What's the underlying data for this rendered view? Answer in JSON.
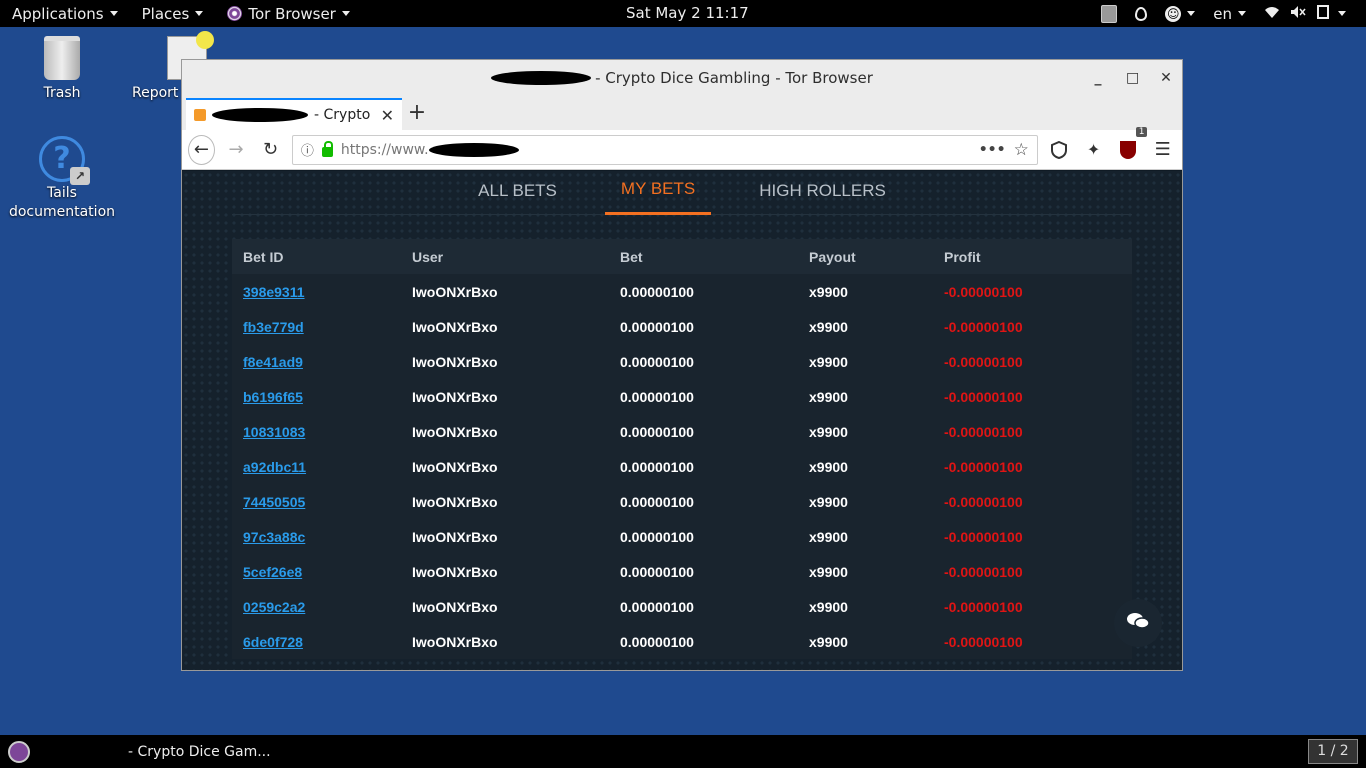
{
  "top_panel": {
    "applications": "Applications",
    "places": "Places",
    "tor_browser": "Tor Browser",
    "clock": "Sat May 2  11:17",
    "language": "en"
  },
  "desktop": {
    "trash": "Trash",
    "report": "Report",
    "docs_line1": "Tails",
    "docs_line2": "documentation"
  },
  "window": {
    "title": "- Crypto Dice Gambling - Tor Browser",
    "tab_title": "- Crypto D",
    "url": "https://www.",
    "ublock_count": "1"
  },
  "bet_tabs": [
    {
      "label": "ALL BETS",
      "active": false
    },
    {
      "label": "MY BETS",
      "active": true
    },
    {
      "label": "HIGH ROLLERS",
      "active": false
    }
  ],
  "table": {
    "headers": [
      "Bet ID",
      "User",
      "Bet",
      "Payout",
      "Profit"
    ],
    "rows": [
      [
        "398e9311",
        "IwoONXrBxo",
        "0.00000100",
        "x9900",
        "-0.00000100"
      ],
      [
        "fb3e779d",
        "IwoONXrBxo",
        "0.00000100",
        "x9900",
        "-0.00000100"
      ],
      [
        "f8e41ad9",
        "IwoONXrBxo",
        "0.00000100",
        "x9900",
        "-0.00000100"
      ],
      [
        "b6196f65",
        "IwoONXrBxo",
        "0.00000100",
        "x9900",
        "-0.00000100"
      ],
      [
        "10831083",
        "IwoONXrBxo",
        "0.00000100",
        "x9900",
        "-0.00000100"
      ],
      [
        "a92dbc11",
        "IwoONXrBxo",
        "0.00000100",
        "x9900",
        "-0.00000100"
      ],
      [
        "74450505",
        "IwoONXrBxo",
        "0.00000100",
        "x9900",
        "-0.00000100"
      ],
      [
        "97c3a88c",
        "IwoONXrBxo",
        "0.00000100",
        "x9900",
        "-0.00000100"
      ],
      [
        "5cef26e8",
        "IwoONXrBxo",
        "0.00000100",
        "x9900",
        "-0.00000100"
      ],
      [
        "0259c2a2",
        "IwoONXrBxo",
        "0.00000100",
        "x9900",
        "-0.00000100"
      ],
      [
        "6de0f728",
        "IwoONXrBxo",
        "0.00000100",
        "x9900",
        "-0.00000100"
      ]
    ]
  },
  "taskbar": {
    "task_title": "- Crypto Dice Gam...",
    "workspace": "1 / 2"
  },
  "colors": {
    "accent_orange": "#f37021",
    "link_blue": "#2a9bea",
    "loss_red": "#e01414",
    "desktop_blue": "#1f4a8f"
  }
}
